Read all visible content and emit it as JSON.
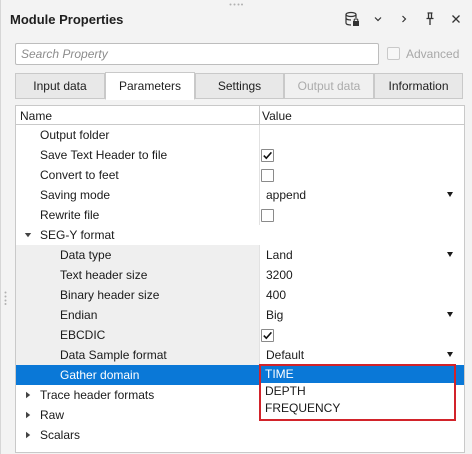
{
  "header": {
    "title": "Module Properties",
    "icons": [
      "database-lock-icon",
      "chevron-down-icon",
      "chevron-right-icon",
      "pin-icon",
      "close-icon"
    ]
  },
  "search": {
    "placeholder": "Search Property",
    "value": "",
    "advanced_label": "Advanced",
    "advanced_checked": false
  },
  "tabs": [
    {
      "label": "Input data",
      "state": "normal"
    },
    {
      "label": "Parameters",
      "state": "active"
    },
    {
      "label": "Settings",
      "state": "normal"
    },
    {
      "label": "Output data",
      "state": "disabled"
    },
    {
      "label": "Information",
      "state": "normal"
    }
  ],
  "grid": {
    "columns": {
      "name": "Name",
      "value": "Value"
    },
    "rows": [
      {
        "name": "Output folder",
        "value": ""
      },
      {
        "name": "Save Text Header to file",
        "checked": true
      },
      {
        "name": "Convert to feet",
        "checked": false
      },
      {
        "name": "Saving mode",
        "value": "append",
        "dropdown": true
      },
      {
        "name": "Rewrite file",
        "checked": false
      },
      {
        "name": "SEG-Y format",
        "group": true,
        "expanded": true
      },
      {
        "name": "Data type",
        "value": "Land",
        "dropdown": true
      },
      {
        "name": "Text header size",
        "value": "3200"
      },
      {
        "name": "Binary header size",
        "value": "400"
      },
      {
        "name": "Endian",
        "value": "Big",
        "dropdown": true
      },
      {
        "name": "EBCDIC",
        "checked": true
      },
      {
        "name": "Data Sample format",
        "value": "Default",
        "dropdown": true
      },
      {
        "name": "Gather domain",
        "selected": true
      },
      {
        "name": "Trace header formats",
        "group": true,
        "expanded": false
      },
      {
        "name": "Raw",
        "group": true,
        "expanded": false
      },
      {
        "name": "Scalars",
        "group": true,
        "expanded": false
      }
    ]
  },
  "gather_domain_dropdown": {
    "options": [
      "TIME",
      "DEPTH",
      "FREQUENCY"
    ],
    "selected": "TIME",
    "highlight_color": "#d2232a"
  },
  "colors": {
    "selection": "#0a78d7",
    "highlight_border": "#d2232a",
    "panel_bg": "#f3f3f3"
  }
}
